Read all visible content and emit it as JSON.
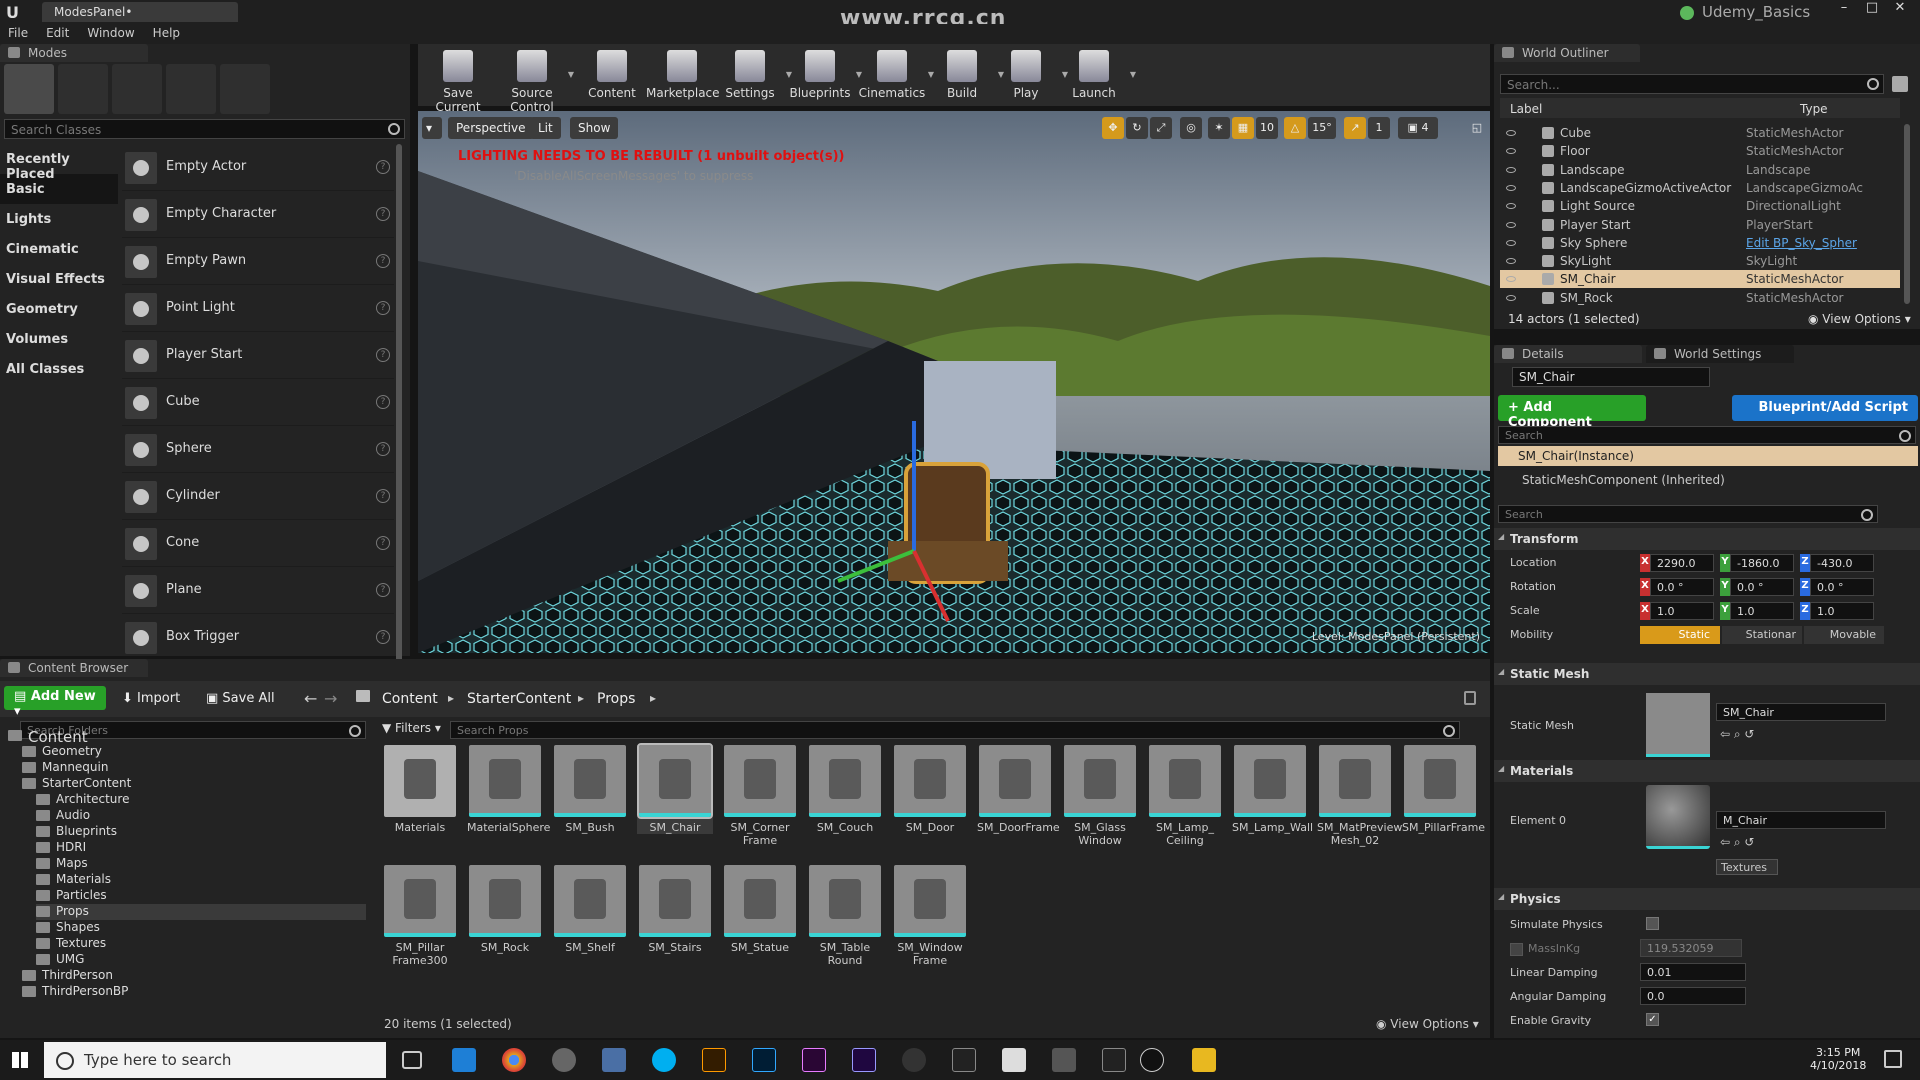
{
  "titlebar": {
    "tab": "ModesPanel•",
    "watermark": "www.rrcg.cn",
    "project": "Udemy_Basics"
  },
  "menu": [
    "File",
    "Edit",
    "Window",
    "Help"
  ],
  "modes": {
    "tab": "Modes",
    "search_placeholder": "Search Classes",
    "categories": [
      "Recently Placed",
      "Basic",
      "Lights",
      "Cinematic",
      "Visual Effects",
      "Geometry",
      "Volumes",
      "All Classes"
    ],
    "classes": [
      "Empty Actor",
      "Empty Character",
      "Empty Pawn",
      "Point Light",
      "Player Start",
      "Cube",
      "Sphere",
      "Cylinder",
      "Cone",
      "Plane",
      "Box Trigger"
    ]
  },
  "toolbar": [
    "Save Current",
    "Source Control",
    "Content",
    "Marketplace",
    "Settings",
    "Blueprints",
    "Cinematics",
    "Build",
    "Play",
    "Launch"
  ],
  "viewport": {
    "perspective": "Perspective",
    "lit": "Lit",
    "show": "Show",
    "grid": "10",
    "angle": "15°",
    "scale": "1",
    "camspeed": "4",
    "warning": "LIGHTING NEEDS TO BE REBUILT (1 unbuilt object(s))",
    "suppress": "'DisableAllScreenMessages' to suppress",
    "level": "Level: ModesPanel (Persistent)"
  },
  "outliner": {
    "tab": "World Outliner",
    "search_placeholder": "Search...",
    "col_label": "Label",
    "col_type": "Type",
    "rows": [
      {
        "label": "Cube",
        "type": "StaticMeshActor"
      },
      {
        "label": "Floor",
        "type": "StaticMeshActor"
      },
      {
        "label": "Landscape",
        "type": "Landscape"
      },
      {
        "label": "LandscapeGizmoActiveActor",
        "type": "LandscapeGizmoAc"
      },
      {
        "label": "Light Source",
        "type": "DirectionalLight"
      },
      {
        "label": "Player Start",
        "type": "PlayerStart"
      },
      {
        "label": "Sky Sphere",
        "type": "Edit BP_Sky_Spher"
      },
      {
        "label": "SkyLight",
        "type": "SkyLight"
      },
      {
        "label": "SM_Chair",
        "type": "StaticMeshActor"
      },
      {
        "label": "SM_Rock",
        "type": "StaticMeshActor"
      }
    ],
    "count": "14 actors (1 selected)",
    "view_options": "View Options"
  },
  "details": {
    "tab": "Details",
    "tab2": "World Settings",
    "name": "SM_Chair",
    "add_component": "+ Add Component",
    "blueprint": "Blueprint/Add Script",
    "search_placeholder": "Search",
    "instance": "SM_Chair(Instance)",
    "component": "StaticMeshComponent (Inherited)",
    "search2_placeholder": "Search",
    "transform": "Transform",
    "location_lbl": "Location",
    "rotation_lbl": "Rotation",
    "scale_lbl": "Scale",
    "mobility_lbl": "Mobility",
    "loc": [
      "2290.0",
      "-1860.0",
      "-430.0"
    ],
    "rot": [
      "0.0 °",
      "0.0 °",
      "0.0 °"
    ],
    "scl": [
      "1.0",
      "1.0",
      "1.0"
    ],
    "mob": [
      "Static",
      "Stationar",
      "Movable"
    ],
    "static_mesh_sect": "Static Mesh",
    "static_mesh_lbl": "Static Mesh",
    "static_mesh_val": "SM_Chair",
    "materials_sect": "Materials",
    "element0": "Element 0",
    "material_val": "M_Chair",
    "textures": "Textures",
    "physics_sect": "Physics",
    "simulate": "Simulate Physics",
    "mass": "MassInKg",
    "mass_val": "119.532059",
    "lin_damp": "Linear Damping",
    "lin_damp_val": "0.01",
    "ang_damp": "Angular Damping",
    "ang_damp_val": "0.0",
    "gravity": "Enable Gravity"
  },
  "content_browser": {
    "tab": "Content Browser",
    "add_new": "Add New",
    "import": "Import",
    "save_all": "Save All",
    "path": [
      "Content",
      "StarterContent",
      "Props"
    ],
    "search_folders": "Search Folders",
    "filters": "Filters",
    "search_props": "Search Props",
    "folders": [
      {
        "name": "Content",
        "level": 0
      },
      {
        "name": "Geometry",
        "level": 1
      },
      {
        "name": "Mannequin",
        "level": 1
      },
      {
        "name": "StarterContent",
        "level": 1
      },
      {
        "name": "Architecture",
        "level": 2
      },
      {
        "name": "Audio",
        "level": 2
      },
      {
        "name": "Blueprints",
        "level": 2
      },
      {
        "name": "HDRI",
        "level": 2
      },
      {
        "name": "Maps",
        "level": 2
      },
      {
        "name": "Materials",
        "level": 2
      },
      {
        "name": "Particles",
        "level": 2
      },
      {
        "name": "Props",
        "level": 2
      },
      {
        "name": "Shapes",
        "level": 2
      },
      {
        "name": "Textures",
        "level": 2
      },
      {
        "name": "UMG",
        "level": 2
      },
      {
        "name": "ThirdPerson",
        "level": 1
      },
      {
        "name": "ThirdPersonBP",
        "level": 1
      }
    ],
    "assets": [
      "Materials",
      "MaterialSphere",
      "SM_Bush",
      "SM_Chair",
      "SM_Corner Frame",
      "SM_Couch",
      "SM_Door",
      "SM_DoorFrame",
      "SM_Glass Window",
      "SM_Lamp_ Ceiling",
      "SM_Lamp_Wall",
      "SM_MatPreview Mesh_02",
      "SM_PillarFrame",
      "SM_Pillar Frame300",
      "SM_Rock",
      "SM_Shelf",
      "SM_Stairs",
      "SM_Statue",
      "SM_Table Round",
      "SM_Window Frame"
    ],
    "count": "20 items (1 selected)",
    "view_options": "View Options"
  },
  "taskbar": {
    "search": "Type here to search",
    "time": "3:15 PM",
    "date": "4/10/2018"
  }
}
